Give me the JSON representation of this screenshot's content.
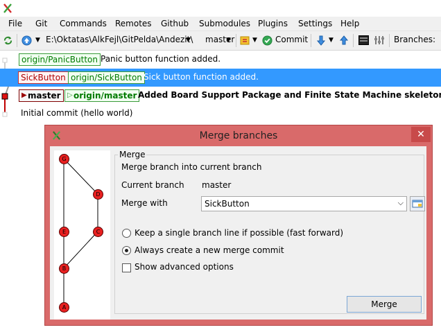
{
  "menubar": {
    "items": [
      "File",
      "Git",
      "Commands",
      "Remotes",
      "Github",
      "Submodules",
      "Plugins",
      "Settings",
      "Help"
    ]
  },
  "toolbar": {
    "repo_path": "E:\\Oktatas\\AlkFejl\\GitPelda\\Andezit\\",
    "branch": "master",
    "commit_label": "Commit",
    "branches_label": "Branches:"
  },
  "grid": {
    "rows": [
      {
        "labels": [
          {
            "text": "origin/PanicButton",
            "style": "green"
          }
        ],
        "message": "Panic button function added."
      },
      {
        "labels": [
          {
            "text": "SickButton",
            "style": "red"
          },
          {
            "text": "origin/SickButton",
            "style": "green"
          }
        ],
        "message": "Sick button function added.",
        "selected": true
      },
      {
        "labels": [
          {
            "text": "master",
            "style": "head"
          },
          {
            "text": "origin/master",
            "style": "head-remote"
          }
        ],
        "message": "Added Board Support Package and Finite State Machine skeleton.",
        "bold": true
      },
      {
        "labels": [],
        "message": "Initial commit (hello world)"
      }
    ]
  },
  "dialog": {
    "title": "Merge branches",
    "group_label": "Merge",
    "description": "Merge branch into current branch",
    "current_branch_label": "Current branch",
    "current_branch_value": "master",
    "merge_with_label": "Merge with",
    "merge_with_value": "SickButton",
    "option_fast_forward": "Keep a single branch line if possible (fast forward)",
    "option_new_commit": "Always create a new merge commit",
    "selected_option": "new_commit",
    "option_advanced": "Show advanced options",
    "advanced_checked": false,
    "merge_button": "Merge",
    "graph_nodes": [
      "G",
      "D",
      "E",
      "C",
      "B",
      "A"
    ]
  },
  "colors": {
    "selection": "#3399ff",
    "dialog_frame": "#d96a6a",
    "node_fill": "#e82020",
    "label_green": "#007a00",
    "label_red": "#b00000"
  },
  "icons": [
    "gitext-logo-icon",
    "refresh-icon",
    "push-icon",
    "commit-check-icon",
    "pull-icon",
    "push-arrow-icon",
    "console-icon",
    "settings-icon",
    "folder-browse-icon",
    "close-icon"
  ]
}
